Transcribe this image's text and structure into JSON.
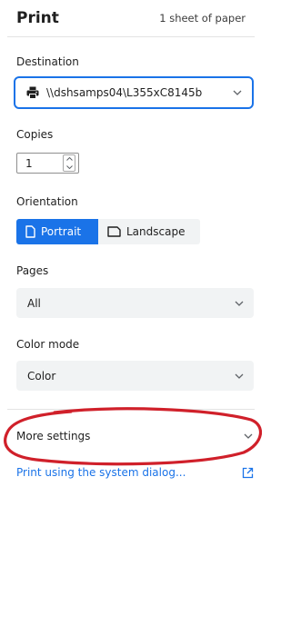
{
  "header": {
    "title": "Print",
    "sheets": "1 sheet of paper"
  },
  "destination": {
    "label": "Destination",
    "value": "\\\\dshsamps04\\L355xC8145b",
    "icon": "printer-icon"
  },
  "copies": {
    "label": "Copies",
    "value": "1"
  },
  "orientation": {
    "label": "Orientation",
    "options": [
      {
        "label": "Portrait",
        "selected": true
      },
      {
        "label": "Landscape",
        "selected": false
      }
    ]
  },
  "pages": {
    "label": "Pages",
    "value": "All"
  },
  "color_mode": {
    "label": "Color mode",
    "value": "Color"
  },
  "more_settings": {
    "label": "More settings"
  },
  "system_dialog": {
    "label": "Print using the system dialog...",
    "icon": "open-external-icon"
  },
  "colors": {
    "accent": "#1a73e8",
    "annotation": "#d0202a",
    "dropdown_bg": "#f1f3f4"
  }
}
